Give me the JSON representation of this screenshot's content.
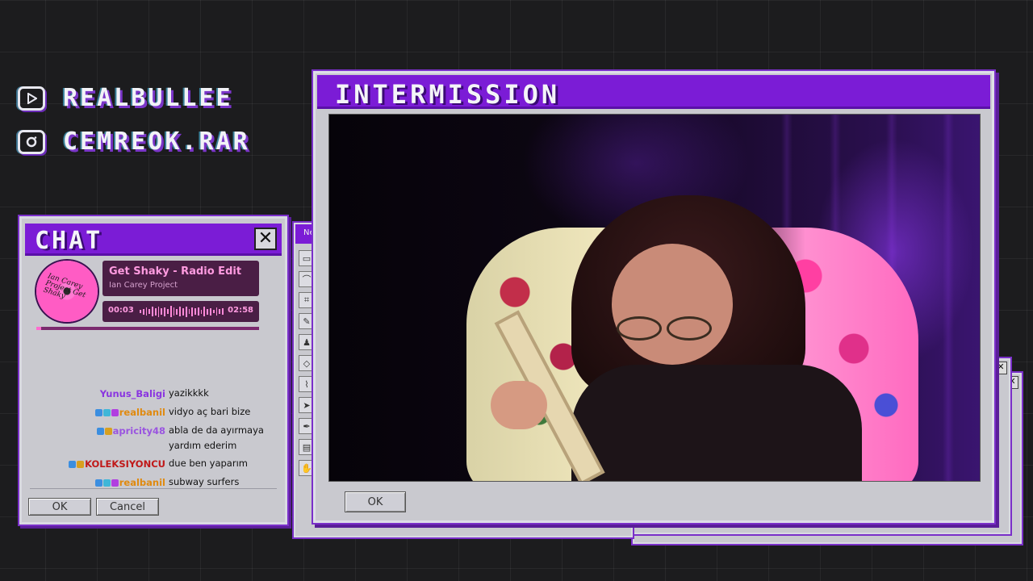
{
  "socials": [
    {
      "icon": "youtube-icon",
      "handle": "REALBULLEE"
    },
    {
      "icon": "instagram-icon",
      "handle": "CEMREOK.RAR"
    }
  ],
  "chat": {
    "title": "CHAT",
    "close_label": "✕",
    "now_playing": {
      "track": "Get Shaky - Radio Edit",
      "artist": "Ian Carey Project",
      "elapsed": "00:03",
      "duration": "02:58",
      "progress": 0.02,
      "disc_label": "Ian Carey Project Get Shaky"
    },
    "messages": [
      {
        "user": "Yunus_Baligi",
        "user_color": "#8a35e0",
        "badges": [],
        "text": "yazikkkk"
      },
      {
        "user": "realbanil",
        "user_color": "#e08a10",
        "badges": [
          "#3b8ee0",
          "#3fb6d8",
          "#b13fe0"
        ],
        "text": "vidyo aç bari bize"
      },
      {
        "user": "apricity48",
        "user_color": "#9a55e0",
        "badges": [
          "#3b8ee0",
          "#d8a020"
        ],
        "text": "abla de da ayırmaya yardım ederim"
      },
      {
        "user": "KOLEKSIYONCU",
        "user_color": "#c01818",
        "badges": [
          "#3b8ee0",
          "#d8a020"
        ],
        "text": "due ben yaparım"
      },
      {
        "user": "realbanil",
        "user_color": "#e08a10",
        "badges": [
          "#3b8ee0",
          "#3fb6d8",
          "#b13fe0"
        ],
        "text": "subway surfers"
      }
    ],
    "ok_label": "OK",
    "cancel_label": "Cancel"
  },
  "back_window": {
    "title": "Ne"
  },
  "main": {
    "title": "INTERMISSION",
    "ok_label": "OK"
  },
  "colors": {
    "accent": "#7b1cd6",
    "window": "#c9c9cf",
    "background": "#1c1c1e"
  }
}
